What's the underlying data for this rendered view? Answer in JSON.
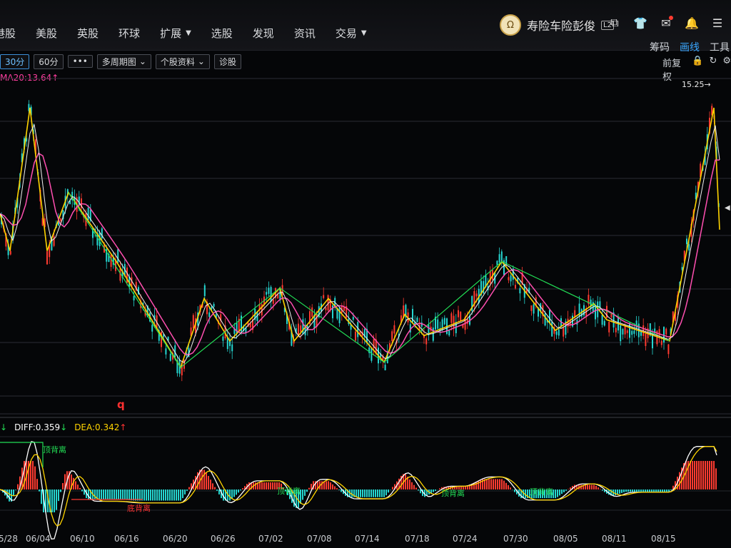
{
  "nav": {
    "items": [
      "港股",
      "美股",
      "英股",
      "环球",
      "扩展",
      "选股",
      "发现",
      "资讯",
      "交易"
    ],
    "dropdown_items": [
      "扩展",
      "交易"
    ]
  },
  "user": {
    "avatar_glyph": "Ω",
    "name": "寿险车险彭俊",
    "level": "L2"
  },
  "right_links": [
    "筹码",
    "画线",
    "工具"
  ],
  "toolbar": {
    "period_30": "30分",
    "period_60": "60分",
    "more": "•••",
    "multi_period": "多周期图",
    "stock_info": "个股资料",
    "diagnose": "诊股"
  },
  "right_tools": {
    "adjust": "前复权"
  },
  "indicators": {
    "ma20": "MA20:13.64↑",
    "diff": "DIFF:0.359",
    "dea": "DEA:0.342",
    "price_max": "15.25→",
    "q_mark": "q"
  },
  "divergence_labels": [
    {
      "text": "顶背离",
      "color": "#22dd55"
    },
    {
      "text": "底背离",
      "color": "#ff3333"
    },
    {
      "text": "顶背离",
      "color": "#22dd55"
    },
    {
      "text": "顶背离",
      "color": "#22dd55"
    },
    {
      "text": "顶背离",
      "color": "#22dd55"
    }
  ],
  "x_axis": [
    "5/28",
    "06/04",
    "06/10",
    "06/16",
    "06/20",
    "06/26",
    "07/02",
    "07/08",
    "07/14",
    "07/18",
    "07/24",
    "07/30",
    "08/05",
    "08/11",
    "08/15"
  ],
  "colors": {
    "up": "#ff3b30",
    "down": "#25d6d0",
    "ma_pink": "#ff4fb0",
    "zigzag_yellow": "#ffd400",
    "zigzag_green": "#22dd55",
    "macd_white": "#ffffff",
    "active_blue": "#3aa7ff"
  },
  "chart_data": {
    "type": "line",
    "series": [
      {
        "name": "MA20",
        "values": [
          14.2,
          14.1,
          13.8,
          13.2,
          12.9,
          12.7,
          12.4,
          12.0,
          11.8,
          11.5,
          11.4,
          11.3,
          11.3,
          11.4,
          11.3,
          11.3,
          11.2,
          11.2,
          11.3,
          11.4,
          11.5,
          11.6,
          11.5,
          11.4,
          11.3,
          11.2,
          11.3,
          11.4,
          11.9,
          12.6,
          13.64
        ]
      },
      {
        "name": "DIFF",
        "values": [
          0.6,
          0.4,
          0.2,
          -0.1,
          -0.2,
          -0.1,
          -0.15,
          -0.2,
          -0.1,
          0.0,
          0.05,
          0.1,
          0.05,
          -0.05,
          0.0,
          0.02,
          0.05,
          0.1,
          0.08,
          0.0,
          -0.05,
          0.0,
          0.05,
          0.03,
          0.0,
          -0.02,
          0.0,
          0.05,
          0.15,
          0.3,
          0.359
        ]
      },
      {
        "name": "DEA",
        "values": [
          0.55,
          0.45,
          0.3,
          0.05,
          -0.1,
          -0.12,
          -0.13,
          -0.15,
          -0.12,
          -0.05,
          0.0,
          0.05,
          0.06,
          0.0,
          -0.01,
          0.0,
          0.03,
          0.07,
          0.08,
          0.03,
          -0.02,
          -0.01,
          0.03,
          0.03,
          0.01,
          -0.01,
          -0.01,
          0.02,
          0.1,
          0.25,
          0.342
        ]
      }
    ]
  }
}
